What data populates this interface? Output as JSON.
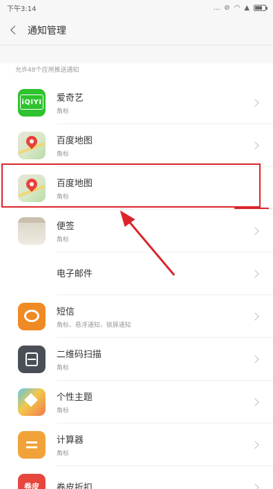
{
  "status_bar": {
    "time": "下午3:14",
    "indicators": [
      "...",
      "mute-icon",
      "wifi-icon",
      "signal-icon",
      "battery-icon"
    ]
  },
  "header": {
    "title": "通知管理",
    "back_icon": "chevron-left-icon"
  },
  "section_title": "允许48个应用推送通知",
  "apps": [
    {
      "name": "爱奇艺",
      "sub": "角标",
      "icon": "iqiyi-icon",
      "icon_text": "iQIYI"
    },
    {
      "name": "百度地图",
      "sub": "角标",
      "icon": "baidu-map-icon"
    },
    {
      "name": "百度地图",
      "sub": "角标",
      "icon": "baidu-map-icon",
      "highlighted": true
    },
    {
      "name": "便签",
      "sub": "角标",
      "icon": "notes-icon"
    },
    {
      "name": "电子邮件",
      "sub": "",
      "icon": "email-icon"
    },
    {
      "name": "短信",
      "sub": "角标、悬浮通知、锁屏通知",
      "icon": "sms-icon"
    },
    {
      "name": "二维码扫描",
      "sub": "角标",
      "icon": "qr-scan-icon"
    },
    {
      "name": "个性主题",
      "sub": "角标",
      "icon": "theme-icon"
    },
    {
      "name": "计算器",
      "sub": "角标",
      "icon": "calculator-icon"
    },
    {
      "name": "卷皮折扣",
      "sub": "",
      "icon": "juanpi-icon",
      "icon_text": "卷皮"
    }
  ],
  "colors": {
    "highlight": "#d9252b",
    "background": "#ffffff",
    "header_bg": "#f7f7f7"
  }
}
